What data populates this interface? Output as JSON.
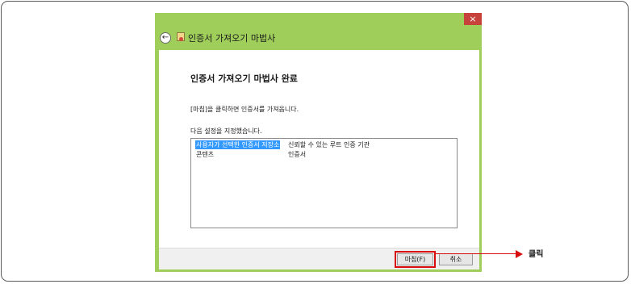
{
  "window": {
    "title": "인증서 가져오기 마법사",
    "close_glyph": "×",
    "back_glyph": "←"
  },
  "content": {
    "heading": "인증서 가져오기 마법사 완료",
    "description": "[마침]을 클릭하면 인증서를 가져옵니다.",
    "settings_label": "다음 설정을 지정했습니다.",
    "settings": [
      {
        "key": "사용자가 선택한 인증서 저장소",
        "value": "신뢰할 수 있는 루트 인증 기관"
      },
      {
        "key": "콘텐츠",
        "value": "인증서"
      }
    ]
  },
  "buttons": {
    "finish": "마침(F)",
    "cancel": "취소"
  },
  "annotation": {
    "label": "클릭",
    "color": "#d80c0c"
  },
  "icons": [
    "back-arrow-icon",
    "certificate-wizard-icon",
    "close-icon",
    "red-arrow-icon"
  ],
  "colors": {
    "window_frame": "#9fcf5a",
    "close_button": "#c7423a",
    "selection": "#3399ff"
  }
}
